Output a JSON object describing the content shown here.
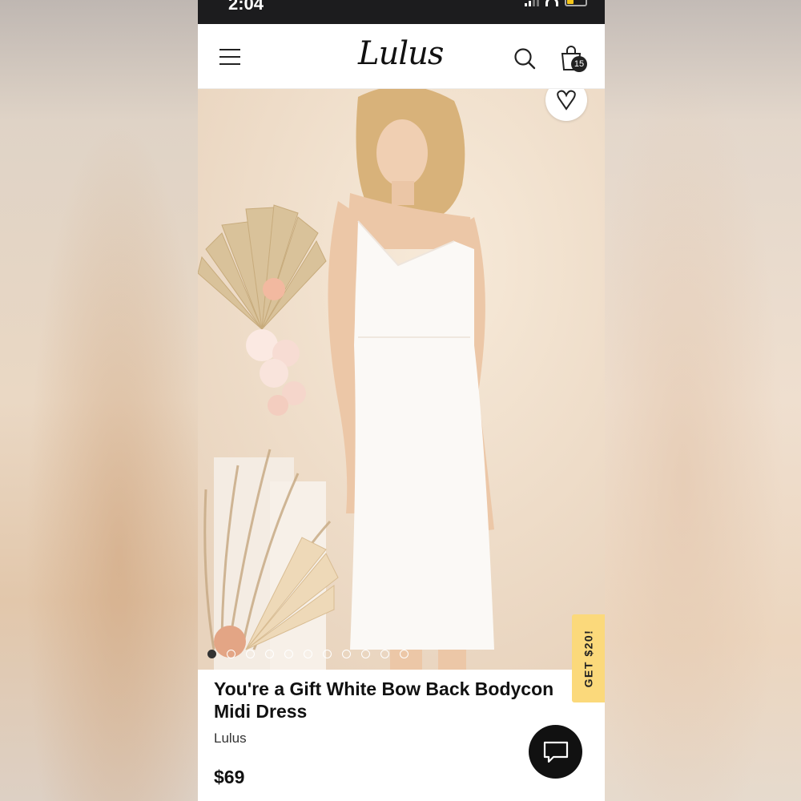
{
  "status_bar": {
    "time": "2:04"
  },
  "header": {
    "logo": "Lulus",
    "bag_count": "15",
    "icons": [
      "menu-icon",
      "search-icon",
      "shopping-bag-icon"
    ]
  },
  "gallery": {
    "image": "woman in white sleeveless bodycon midi dress with dried floral arrangement",
    "dot_count": 11,
    "active_index": 0
  },
  "promo": {
    "label": "GET $20!"
  },
  "product": {
    "title": "You're a Gift White Bow Back Bodycon Midi Dress",
    "brand": "Lulus",
    "price": "$69"
  },
  "colors": {
    "promo_bg": "#fbd97b",
    "status_bar_bg": "#1c1c1e",
    "chat_bg": "#111111"
  }
}
